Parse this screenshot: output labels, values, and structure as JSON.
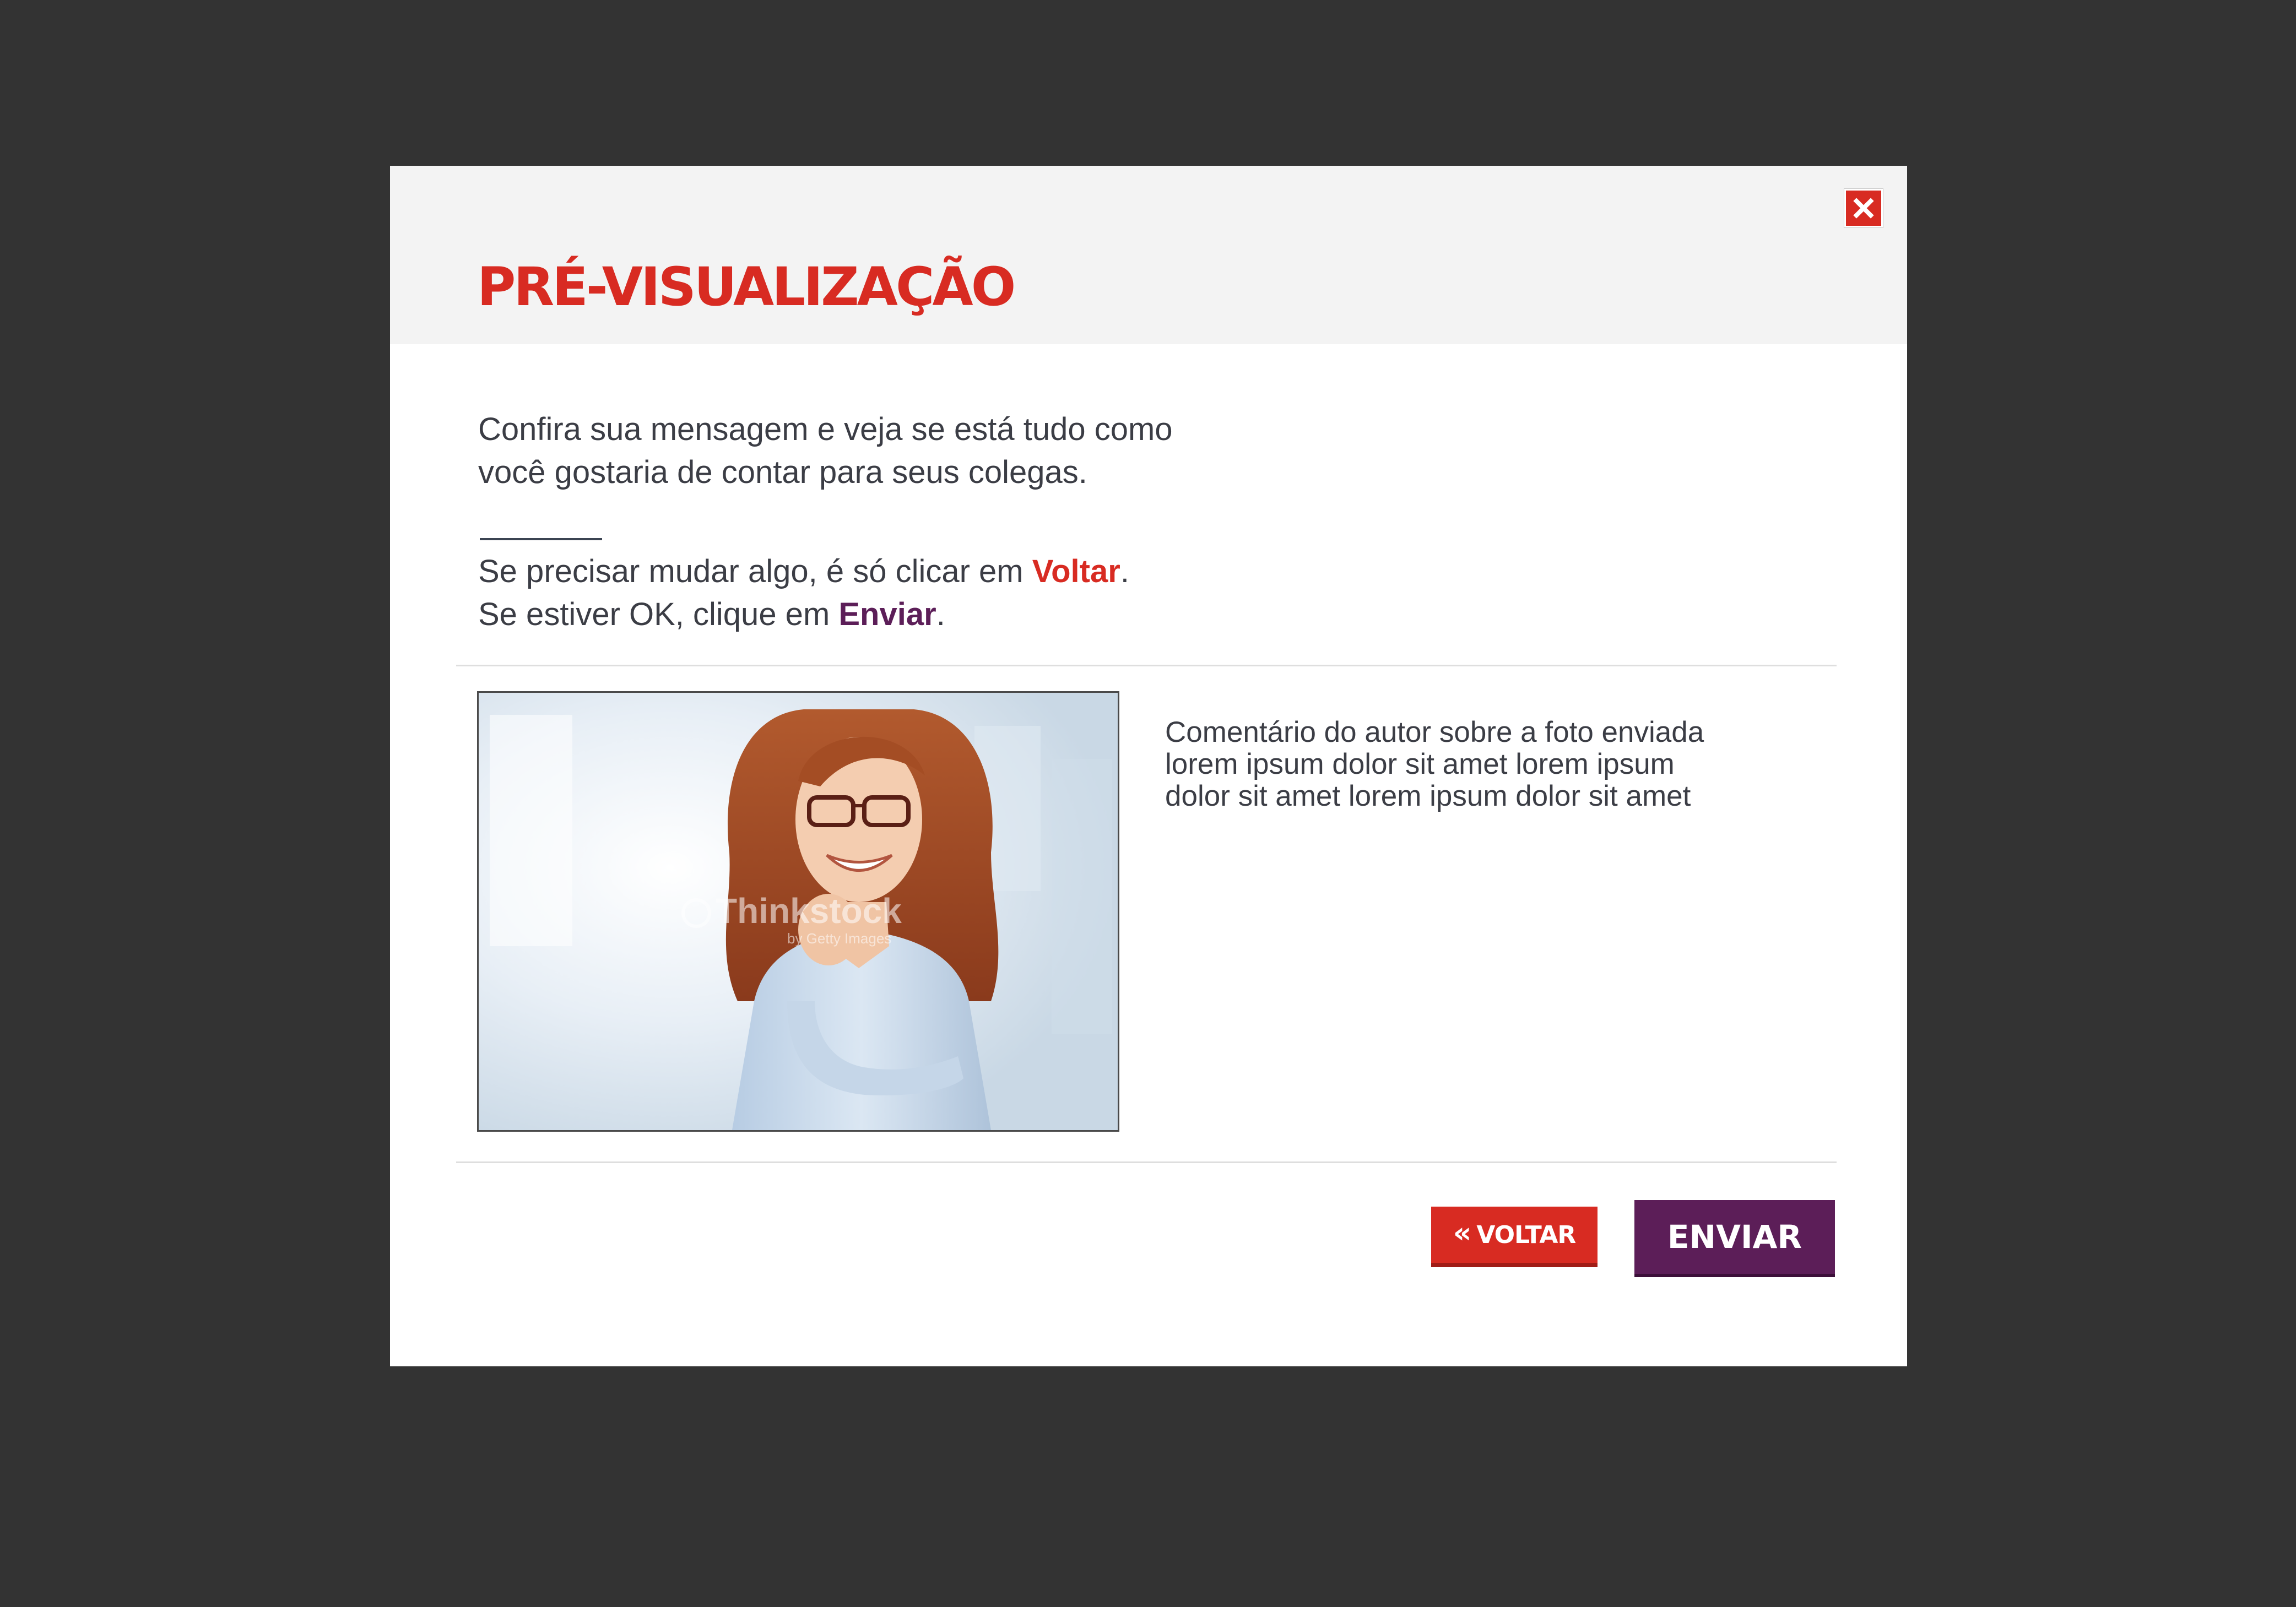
{
  "modal": {
    "title": "PRÉ-VISUALIZAÇÃO",
    "close_icon": "close-icon",
    "intro_lines": [
      "Confira sua mensagem e veja se está tudo como",
      "você gostaria de contar para seus colegas."
    ],
    "instruction_1": {
      "prefix": "Se precisar mudar algo, é só clicar em ",
      "keyword": "Voltar",
      "suffix": "."
    },
    "instruction_2": {
      "prefix": "Se estiver OK, clique em ",
      "keyword": "Enviar",
      "suffix": "."
    },
    "photo": {
      "watermark": "Thinkstock",
      "watermark_sub": "by Getty Images"
    },
    "comment_lines": [
      "Comentário do autor sobre a foto enviada",
      "lorem ipsum dolor sit amet lorem ipsum",
      "dolor sit amet lorem ipsum dolor sit amet"
    ],
    "buttons": {
      "back_icon": "double-chevron-left-icon",
      "back_label": "VOLTAR",
      "send_label": "ENVIAR"
    }
  },
  "colors": {
    "backdrop": "#333333",
    "header_bg": "#f3f3f3",
    "accent_red": "#d82b22",
    "accent_purple": "#5c1e58",
    "body_text": "#3b3d45"
  }
}
